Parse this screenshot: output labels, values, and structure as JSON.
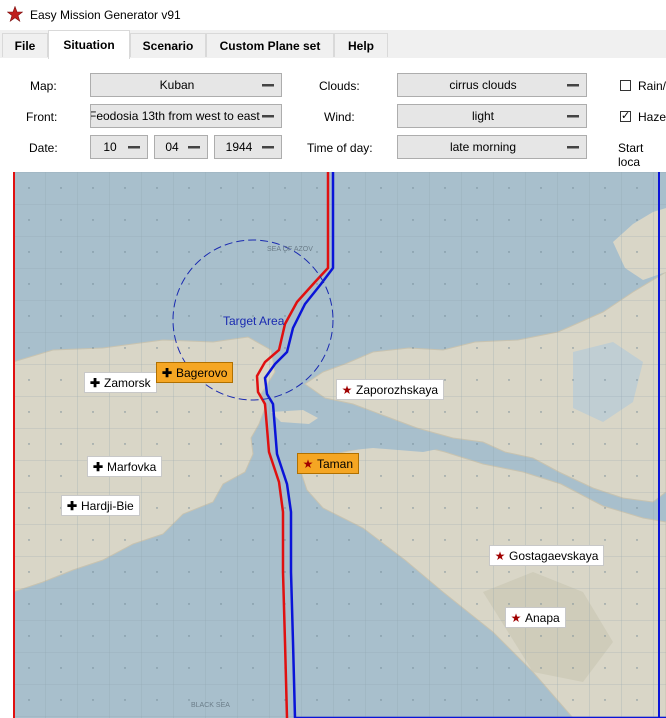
{
  "window": {
    "title": "Easy Mission Generator v91",
    "icon": "red-star-icon"
  },
  "tabs": [
    {
      "label": "File",
      "active": false
    },
    {
      "label": "Situation",
      "active": true
    },
    {
      "label": "Scenario",
      "active": false
    },
    {
      "label": "Custom Plane set",
      "active": false
    },
    {
      "label": "Help",
      "active": false
    }
  ],
  "form": {
    "map_label": "Map:",
    "map_value": "Kuban",
    "front_label": "Front:",
    "front_value": "Feodosia 13th from west to east",
    "date_label": "Date:",
    "date_day": "10",
    "date_month": "04",
    "date_year": "1944",
    "clouds_label": "Clouds:",
    "clouds_value": "cirrus clouds",
    "wind_label": "Wind:",
    "wind_value": "light",
    "time_label": "Time of day:",
    "time_value": "late morning",
    "rain_label": "Rain/",
    "rain_checked": false,
    "haze_label": "Haze",
    "haze_checked": true,
    "start_label": "Start loca"
  },
  "map": {
    "sea_top_label": "SEA OF AZOV",
    "sea_bottom_label": "BLACK SEA",
    "target_label": "Target Area",
    "red_front_color": "#e01010",
    "blue_front_color": "#0a14d8",
    "markers": [
      {
        "label": "Zamorsk",
        "icon": "cross-icon",
        "side": "red",
        "selected": false
      },
      {
        "label": "Bagerovo",
        "icon": "cross-icon",
        "side": "red",
        "selected": true
      },
      {
        "label": "Marfovka",
        "icon": "cross-icon",
        "side": "red",
        "selected": false
      },
      {
        "label": "Hardji-Bie",
        "icon": "cross-icon",
        "side": "red",
        "selected": false
      },
      {
        "label": "Zaporozhskaya",
        "icon": "star-icon",
        "side": "blue",
        "selected": false
      },
      {
        "label": "Taman",
        "icon": "star-icon",
        "side": "blue",
        "selected": true
      },
      {
        "label": "Gostagaevskaya",
        "icon": "star-icon",
        "side": "blue",
        "selected": false
      },
      {
        "label": "Anapa",
        "icon": "star-icon",
        "side": "blue",
        "selected": false
      }
    ]
  }
}
